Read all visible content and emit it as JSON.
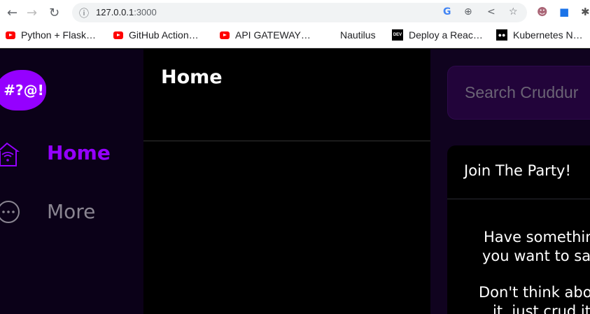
{
  "browser": {
    "url_host": "127.0.0.1",
    "url_port": ":3000",
    "bookmarks": [
      {
        "label": "Python + Flask…",
        "icon": "youtube-icon"
      },
      {
        "label": "GitHub Action…",
        "icon": "youtube-icon"
      },
      {
        "label": "API GATEWAY…",
        "icon": "youtube-icon"
      },
      {
        "label": "Nautilus",
        "icon": "blank-icon"
      },
      {
        "label": "Deploy a Reac…",
        "icon": "dev-icon"
      },
      {
        "label": "Kubernetes N…",
        "icon": "medium-icon"
      }
    ],
    "dev_icon_text": "DEV"
  },
  "sidebar": {
    "logo_text": "#?@!",
    "items": [
      {
        "label": "Home",
        "active": true
      },
      {
        "label": "More",
        "active": false
      }
    ]
  },
  "main": {
    "title": "Home"
  },
  "right": {
    "search_placeholder": "Search Cruddur",
    "card": {
      "title": "Join The Party!",
      "lines": [
        "Have somethin",
        "you want to sa",
        "Don't think abo",
        "it, just crud it"
      ]
    }
  },
  "colors": {
    "accent": "#9500ff",
    "sidebar_bg": "#0b0118",
    "right_bg": "#10031f",
    "search_bg": "#22043a"
  }
}
